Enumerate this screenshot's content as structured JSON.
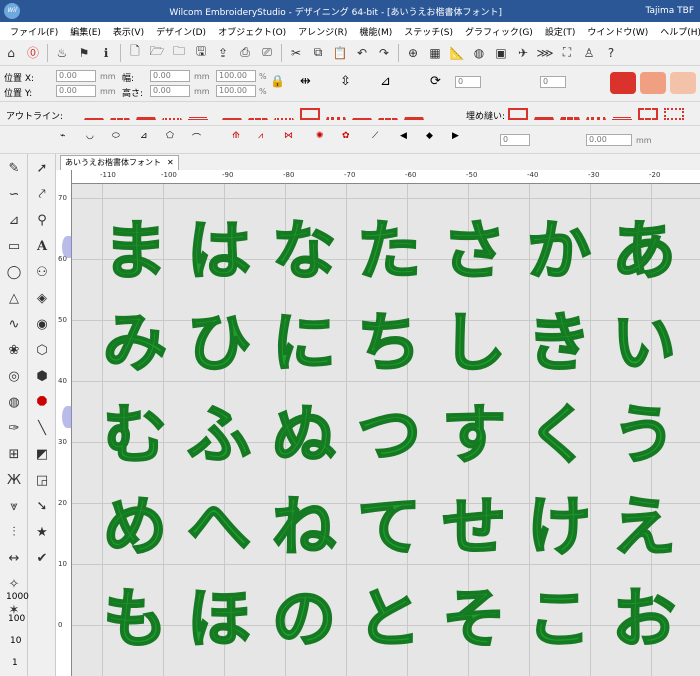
{
  "window": {
    "title": "Wilcom EmbroideryStudio - デザイニング 64-bit - [あいうえお楷書体フォント]",
    "right": "Tajima TBF"
  },
  "menu": [
    "ファイル(F)",
    "編集(E)",
    "表示(V)",
    "デザイン(D)",
    "オブジェクト(O)",
    "アレンジ(R)",
    "機能(M)",
    "ステッチ(S)",
    "グラフィック(G)",
    "設定(T)",
    "ウインドウ(W)",
    "ヘルプ(H)"
  ],
  "position": {
    "x_label": "位置 X:",
    "y_label": "位置 Y:",
    "w_label": "幅:",
    "h_label": "高さ:",
    "x_value": "0.00",
    "y_value": "0.00",
    "w_value": "0.00",
    "h_value": "0.00",
    "unit": "mm",
    "sx": "100.00",
    "sy": "100.00",
    "pct": "%"
  },
  "outline_label": "アウトライン:",
  "fill_label": "埋め縫い:",
  "shape_fields": {
    "a": "0",
    "b": "0.00",
    "unit": "mm"
  },
  "doc_tab": {
    "label": "あいうえお楷書体フォント",
    "close": "✕"
  },
  "ruler_h": [
    "-110",
    "-100",
    "-90",
    "-80",
    "-70",
    "-60",
    "-50",
    "-40",
    "-30",
    "-20"
  ],
  "ruler_v": [
    "70",
    "60",
    "50",
    "40",
    "30",
    "20",
    "10",
    "0"
  ],
  "glyphs": [
    [
      "ま",
      "は",
      "な",
      "た",
      "さ",
      "か",
      "あ"
    ],
    [
      "み",
      "ひ",
      "に",
      "ち",
      "し",
      "き",
      "い"
    ],
    [
      "む",
      "ふ",
      "ぬ",
      "つ",
      "す",
      "く",
      "う"
    ],
    [
      "め",
      "へ",
      "ね",
      "て",
      "せ",
      "け",
      "え"
    ],
    [
      "も",
      "ほ",
      "の",
      "と",
      "そ",
      "こ",
      "お"
    ]
  ],
  "left_counters": [
    "1000",
    "100",
    "10",
    "1"
  ],
  "colors": {
    "titlebar": "#2b5797",
    "glyph": "#1e9e2e",
    "outline_red": "#d9332b"
  }
}
